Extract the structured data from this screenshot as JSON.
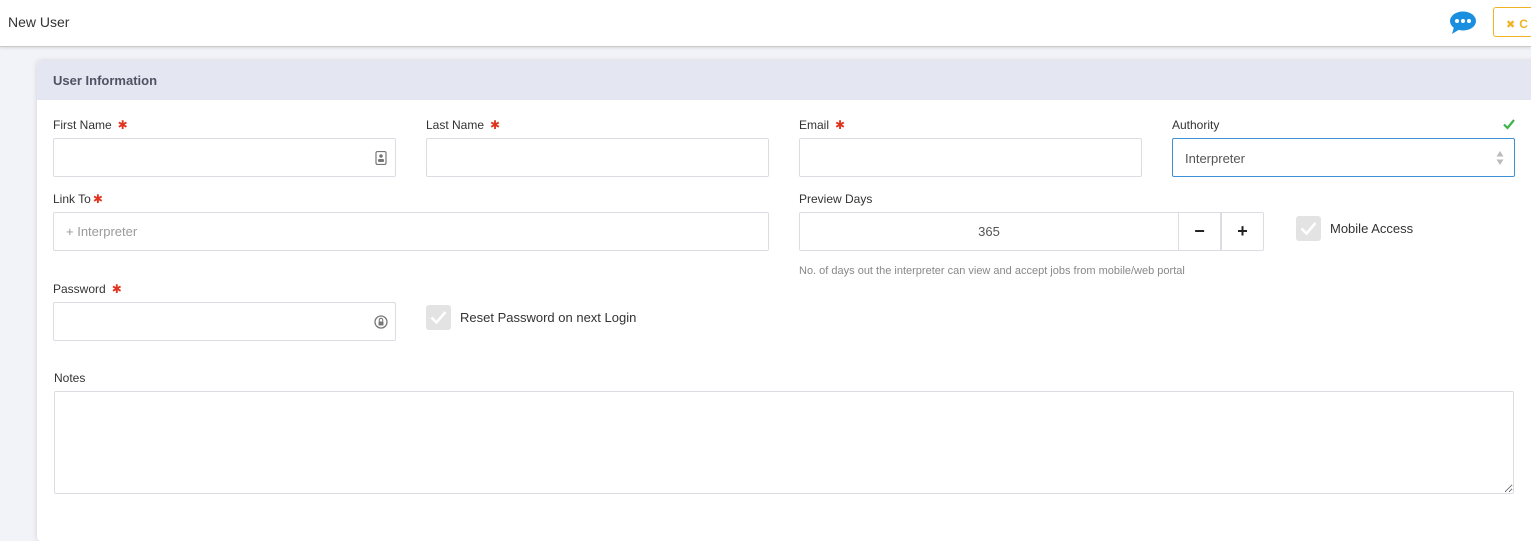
{
  "header": {
    "title": "New User",
    "close_label": "C",
    "close_icon": "times-icon",
    "chat_icon": "chat-bubble-icon"
  },
  "card": {
    "title": "User Information"
  },
  "form": {
    "first_name": {
      "label": "First Name",
      "value": "",
      "placeholder": "",
      "required": "✱"
    },
    "last_name": {
      "label": "Last Name",
      "value": "",
      "placeholder": "",
      "required": "✱"
    },
    "email": {
      "label": "Email",
      "value": "",
      "placeholder": "",
      "required": "✱"
    },
    "authority": {
      "label": "Authority",
      "selected": "Interpreter"
    },
    "link_to": {
      "label": "Link To",
      "value": "",
      "placeholder": "+ Interpreter",
      "required": "✱"
    },
    "preview_days": {
      "label": "Preview Days",
      "value": "365",
      "minus": "−",
      "plus": "+",
      "help": "No. of days out the interpreter can view and accept jobs from mobile/web portal"
    },
    "mobile_access": {
      "label": "Mobile Access"
    },
    "password": {
      "label": "Password",
      "value": "",
      "placeholder": "",
      "required": "✱"
    },
    "reset_password": {
      "label": "Reset Password on next Login"
    },
    "notes": {
      "label": "Notes",
      "value": ""
    }
  },
  "colors": {
    "accent_blue": "#3f8fd7",
    "chat_blue": "#1a8fe0",
    "close_yellow": "#f0b323",
    "required_red": "#e0341e",
    "valid_green": "#3cb44b",
    "header_bg": "#e4e6f2"
  }
}
